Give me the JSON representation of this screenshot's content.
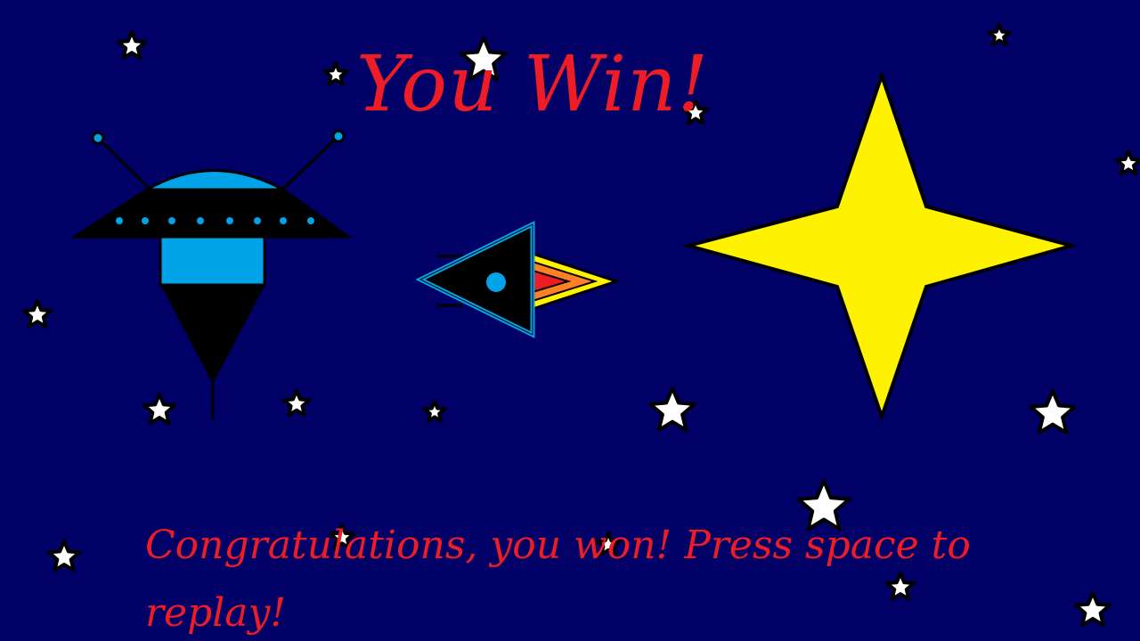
{
  "screen": {
    "title": "You Win!",
    "message": "Congratulations, you won! Press space to replay!"
  },
  "colors": {
    "background": "#000066",
    "text": "#ee1c24",
    "star_fill": "#ffffff",
    "big_star_fill": "#fff200",
    "ufo_accent": "#00a2e8",
    "ship_flame_outer": "#fff200",
    "ship_flame_mid": "#ff7f27",
    "ship_flame_inner": "#ee1c24"
  },
  "icons": {
    "alien_ufo": "ufo-icon",
    "player_ship": "rocket-ship-icon",
    "victory_star": "four-point-star-icon",
    "background_star": "star-icon"
  }
}
